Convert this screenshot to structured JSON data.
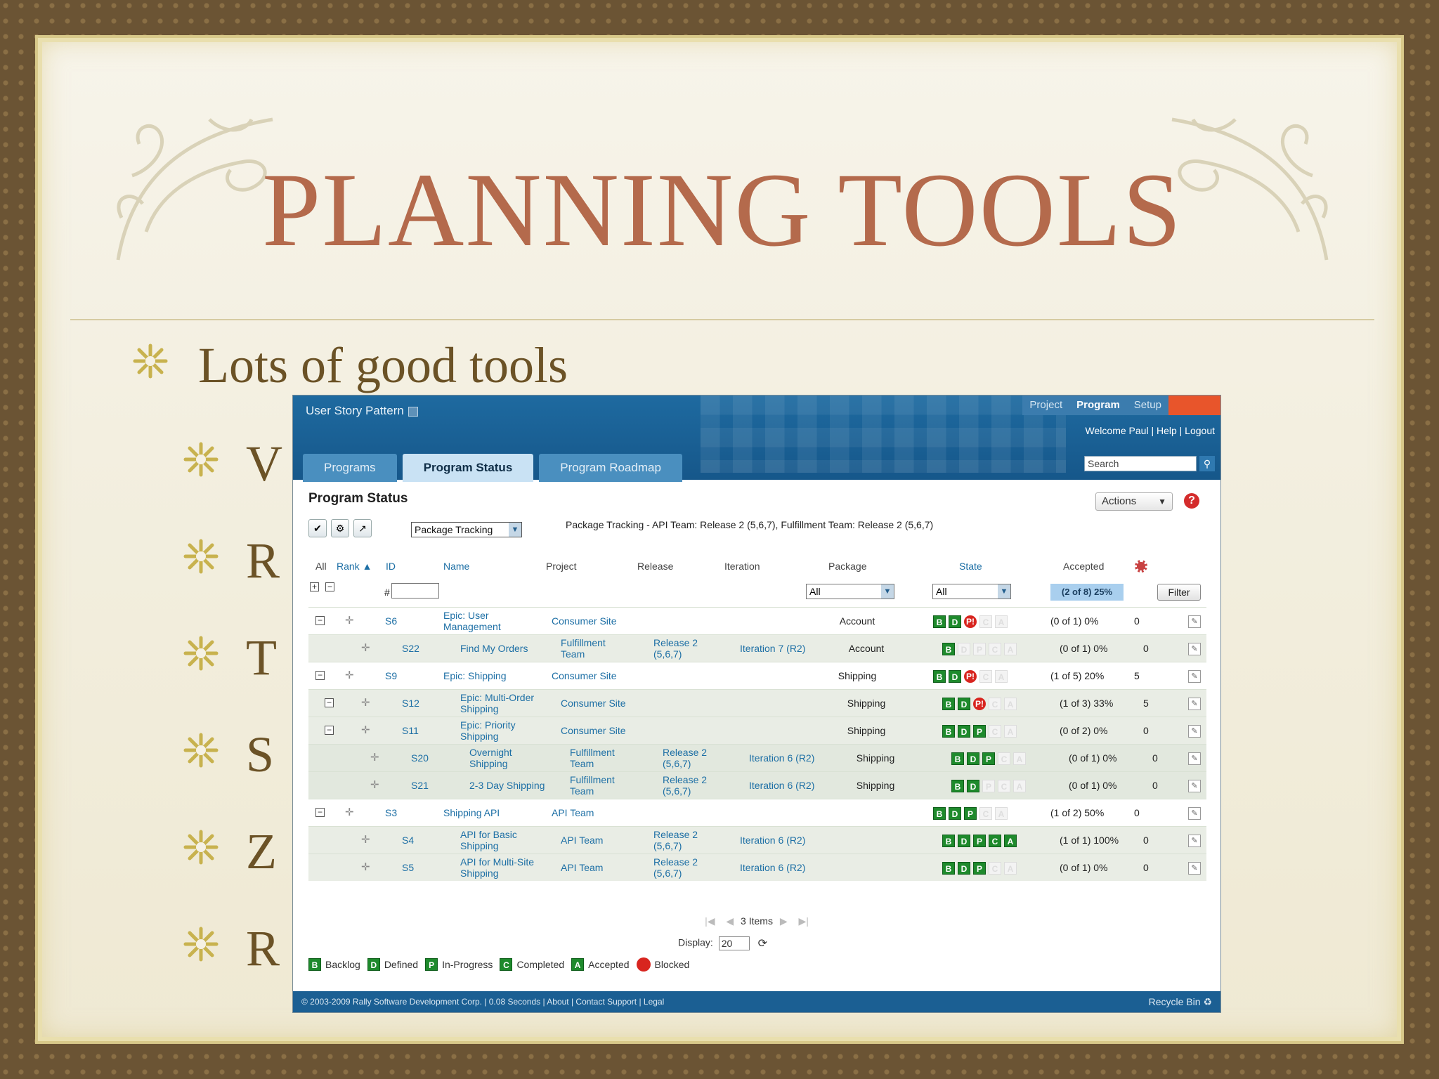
{
  "slide": {
    "title": "PLANNING TOOLS",
    "bullet_main": "Lots of good tools",
    "sub_bullets": [
      "V",
      "R",
      "T",
      "S",
      "Z",
      "R"
    ]
  },
  "app": {
    "name": "User Story Pattern",
    "topnav": [
      "Project",
      "Program",
      "Setup"
    ],
    "welcome": "Welcome Paul | Help | Logout",
    "search_placeholder": "Search",
    "tabs": [
      "Programs",
      "Program Status",
      "Program Roadmap"
    ],
    "active_tab": "Program Status",
    "panel_title": "Program Status",
    "actions_label": "Actions",
    "package_select": "Package Tracking",
    "package_desc": "Package Tracking  -  API Team: Release 2 (5,6,7),  Fulfillment Team: Release 2 (5,6,7)",
    "columns": {
      "all": "All",
      "rank": "Rank",
      "id": "ID",
      "name": "Name",
      "project": "Project",
      "release": "Release",
      "iteration": "Iteration",
      "package": "Package",
      "state": "State",
      "accepted": "Accepted"
    },
    "filters": {
      "id_prefix": "#",
      "package": "All",
      "state": "All",
      "accepted": "(2 of 8) 25%",
      "filter_button": "Filter"
    },
    "rows": [
      {
        "level": 0,
        "id": "S6",
        "name": "Epic: User Management",
        "project": "Consumer Site",
        "release": "",
        "iteration": "",
        "package": "Account",
        "states": [
          "B",
          "D",
          "P!",
          "",
          ""
        ],
        "accepted": "(0 of 1) 0%",
        "pts": "0"
      },
      {
        "level": 1,
        "id": "S22",
        "name": "Find My Orders",
        "project": "Fulfillment Team",
        "release": "Release 2 (5,6,7)",
        "iteration": "Iteration 7 (R2)",
        "package": "Account",
        "states": [
          "B",
          "",
          "",
          "",
          ""
        ],
        "accepted": "(0 of 1) 0%",
        "pts": "0"
      },
      {
        "level": 0,
        "id": "S9",
        "name": "Epic: Shipping",
        "project": "Consumer Site",
        "release": "",
        "iteration": "",
        "package": "Shipping",
        "states": [
          "B",
          "D",
          "P!",
          "",
          ""
        ],
        "accepted": "(1 of 5) 20%",
        "pts": "5"
      },
      {
        "level": 1,
        "id": "S12",
        "name": "Epic: Multi-Order Shipping",
        "project": "Consumer Site",
        "release": "",
        "iteration": "",
        "package": "Shipping",
        "states": [
          "B",
          "D",
          "P!",
          "",
          ""
        ],
        "accepted": "(1 of 3) 33%",
        "pts": "5"
      },
      {
        "level": 1,
        "id": "S11",
        "name": "Epic: Priority Shipping",
        "project": "Consumer Site",
        "release": "",
        "iteration": "",
        "package": "Shipping",
        "states": [
          "B",
          "D",
          "P",
          "",
          ""
        ],
        "accepted": "(0 of 2) 0%",
        "pts": "0"
      },
      {
        "level": 2,
        "id": "S20",
        "name": "Overnight Shipping",
        "project": "Fulfillment Team",
        "release": "Release 2 (5,6,7)",
        "iteration": "Iteration 6 (R2)",
        "package": "Shipping",
        "states": [
          "B",
          "D",
          "P",
          "",
          ""
        ],
        "accepted": "(0 of 1) 0%",
        "pts": "0"
      },
      {
        "level": 2,
        "id": "S21",
        "name": "2-3 Day Shipping",
        "project": "Fulfillment Team",
        "release": "Release 2 (5,6,7)",
        "iteration": "Iteration 6 (R2)",
        "package": "Shipping",
        "states": [
          "B",
          "D",
          "",
          "",
          ""
        ],
        "accepted": "(0 of 1) 0%",
        "pts": "0"
      },
      {
        "level": 0,
        "id": "S3",
        "name": "Shipping API",
        "project": "API Team",
        "release": "",
        "iteration": "",
        "package": "",
        "states": [
          "B",
          "D",
          "P",
          "",
          ""
        ],
        "accepted": "(1 of 2) 50%",
        "pts": "0"
      },
      {
        "level": 1,
        "id": "S4",
        "name": "API for Basic Shipping",
        "project": "API Team",
        "release": "Release 2 (5,6,7)",
        "iteration": "Iteration 6 (R2)",
        "package": "",
        "states": [
          "B",
          "D",
          "P",
          "C",
          "A"
        ],
        "accepted": "(1 of 1) 100%",
        "pts": "0"
      },
      {
        "level": 1,
        "id": "S5",
        "name": "API for Multi-Site Shipping",
        "project": "API Team",
        "release": "Release 2 (5,6,7)",
        "iteration": "Iteration 6 (R2)",
        "package": "",
        "states": [
          "B",
          "D",
          "P",
          "",
          ""
        ],
        "accepted": "(0 of 1) 0%",
        "pts": "0"
      }
    ],
    "pager": {
      "count": "3 Items",
      "display_label": "Display:",
      "display_value": "20"
    },
    "legend": [
      {
        "code": "B",
        "label": "Backlog"
      },
      {
        "code": "D",
        "label": "Defined"
      },
      {
        "code": "P",
        "label": "In-Progress"
      },
      {
        "code": "C",
        "label": "Completed"
      },
      {
        "code": "A",
        "label": "Accepted"
      },
      {
        "code": "",
        "label": "Blocked"
      }
    ],
    "footer": {
      "copyright": "© 2003-2009 Rally Software Development Corp.  | 0.08 Seconds  |  About  |  Contact Support  |  Legal",
      "recycle": "Recycle Bin"
    },
    "colors": {
      "header": "#1e6aa0",
      "state_on": "#1e8a2c",
      "blocked": "#d8251f",
      "title": "#b46a4c"
    }
  }
}
